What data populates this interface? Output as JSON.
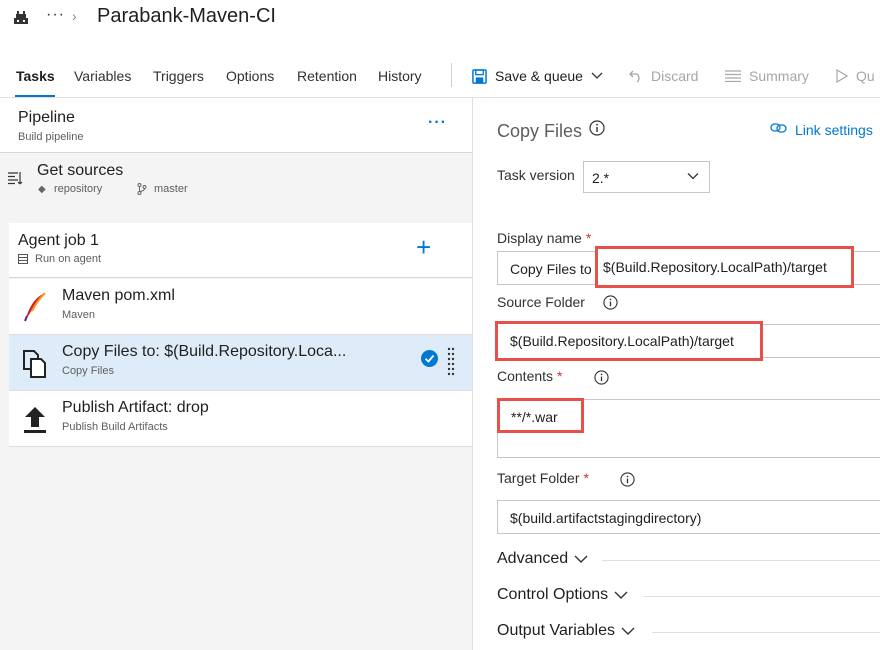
{
  "header": {
    "title": "Parabank-Maven-CI",
    "more": "···",
    "chevron": "›"
  },
  "tabs": [
    {
      "label": "Tasks"
    },
    {
      "label": "Variables"
    },
    {
      "label": "Triggers"
    },
    {
      "label": "Options"
    },
    {
      "label": "Retention"
    },
    {
      "label": "History"
    }
  ],
  "toolbar": {
    "save_label": "Save & queue",
    "discard_label": "Discard",
    "summary_label": "Summary",
    "queue_label": "Qu"
  },
  "pipeline": {
    "title": "Pipeline",
    "subtitle": "Build pipeline",
    "more": "···"
  },
  "get_sources": {
    "title": "Get sources",
    "repo": "repository",
    "branch": "master"
  },
  "agent_job": {
    "title": "Agent job 1",
    "subtitle": "Run on agent",
    "add": "+"
  },
  "tasks": [
    {
      "title": "Maven pom.xml",
      "subtitle": "Maven"
    },
    {
      "title": "Copy Files to: $(Build.Repository.Loca...",
      "subtitle": "Copy Files"
    },
    {
      "title": "Publish Artifact: drop",
      "subtitle": "Publish Build Artifacts"
    }
  ],
  "details": {
    "title": "Copy Files",
    "link_settings": "Link settings",
    "task_version_label": "Task version",
    "task_version_value": "2.*",
    "display_name_label": "Display name",
    "display_name_prefix": "Copy Files to ",
    "display_name_value": "$(Build.Repository.LocalPath)/target",
    "source_folder_label": "Source Folder",
    "source_folder_value": "$(Build.Repository.LocalPath)/target",
    "contents_label": "Contents",
    "contents_value": "**/*.war",
    "target_folder_label": "Target Folder",
    "target_folder_value": "$(build.artifactstagingdirectory)",
    "required_mark": "*",
    "sections": [
      "Advanced",
      "Control Options",
      "Output Variables"
    ]
  },
  "colors": {
    "accent": "#0078d4",
    "highlight": "#e8514a",
    "selected_row": "#deecf9"
  }
}
